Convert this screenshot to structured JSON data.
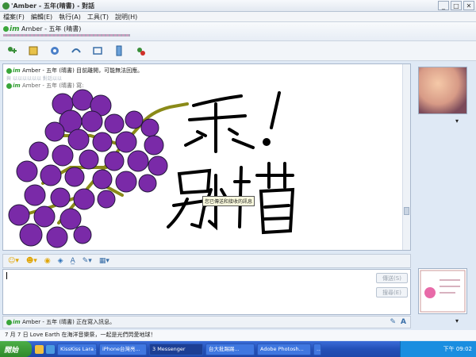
{
  "window": {
    "title": "Amber - 五年(晴書) - 對話",
    "title_prefix": "'"
  },
  "menu": [
    "檔案(F)",
    "編輯(E)",
    "執行(A)",
    "工具(T)",
    "說明(H)"
  ],
  "contact": {
    "logo": "im",
    "name": "Amber - 五年 (晴書)"
  },
  "toolbar_icons": [
    "invite-icon",
    "send-file-icon",
    "video-icon",
    "call-icon",
    "activities-icon",
    "games-icon",
    "block-icon"
  ],
  "conversation": {
    "notice_name": "Amber - 五年 (晴書)",
    "notice_text": " 目前離開，可能無法回應。",
    "partial_line": "與 以以以以以以   對話以以",
    "says_name": "Amber - 五年 (晴書)",
    "says_suffix": " 寫:",
    "tooltip": "您已傳送和接收的訊息"
  },
  "input": {
    "send_label": "傳送(S)",
    "search_label": "搜尋(E)"
  },
  "typing": {
    "name": "Amber - 五年 (晴書)",
    "text": " 正在寫入訊息。"
  },
  "status_line": "7 月 7 日 Love Earth 在海洋音樂祭，一起是光們閃愛地球！",
  "taskbar": {
    "start": "開始",
    "tasks": [
      "KissKiss Lara - [",
      "iPhone台灣亮...",
      "3 Messenger",
      "台大批踢踢...",
      "Adobe Photosh...",
      "..."
    ],
    "clock": "下午 09:02"
  },
  "colors": {
    "grape": "#7a2aa8",
    "stem": "#8a8a18",
    "accent": "#2f9b2f"
  }
}
